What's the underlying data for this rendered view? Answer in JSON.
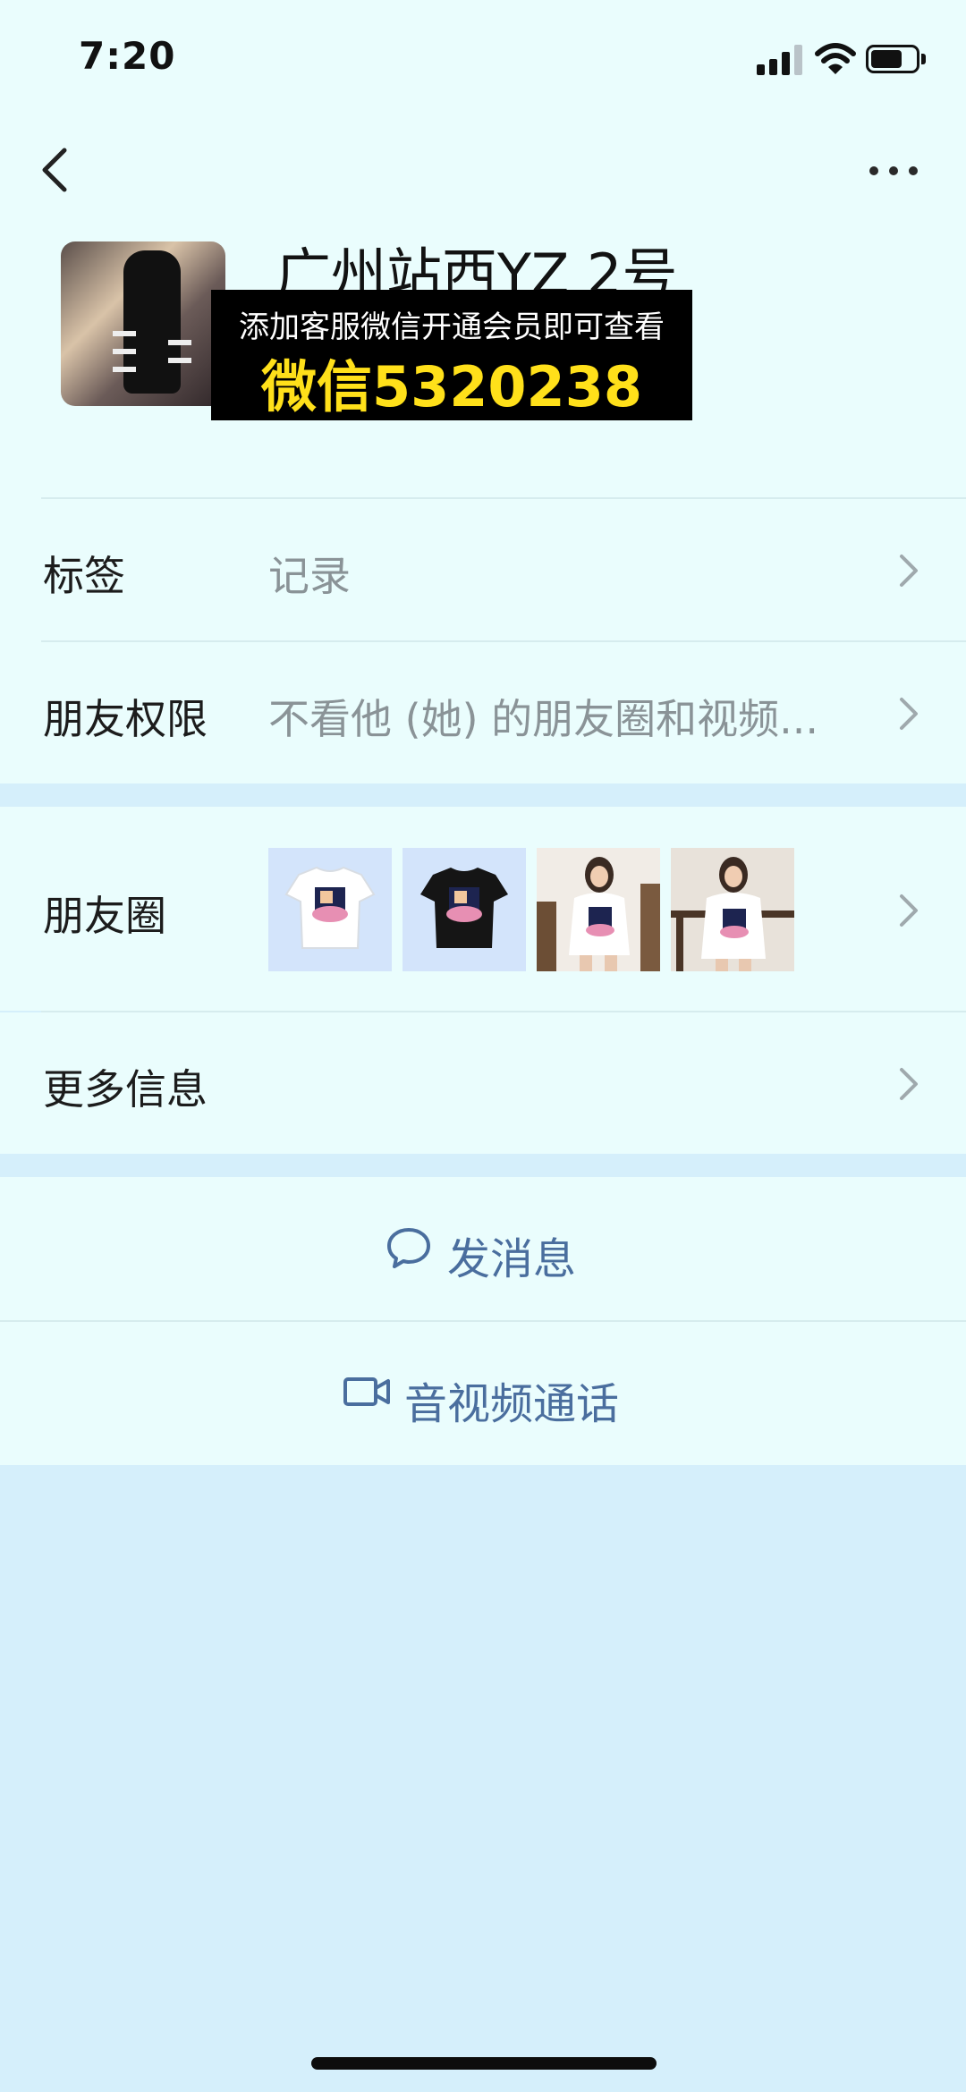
{
  "status_bar": {
    "time": "7:20"
  },
  "profile": {
    "name": "广州站西YZ 2号",
    "banner_line1": "添加客服微信开通会员即可查看",
    "banner_line2": "微信5320238"
  },
  "rows": {
    "tags": {
      "label": "标签",
      "value": "记录"
    },
    "permissions": {
      "label": "朋友权限",
      "value": "不看他 (她) 的朋友圈和视频..."
    },
    "moments": {
      "label": "朋友圈"
    },
    "more_info": {
      "label": "更多信息"
    }
  },
  "actions": {
    "message": "发消息",
    "video_call": "音视频通话"
  },
  "colors": {
    "page_bg": "#eafdfd",
    "section_bg": "#d5effb",
    "action_text": "#4a6e9e",
    "banner_text_yellow": "#ffe01a"
  },
  "icons": {
    "back": "chevron-left-icon",
    "more": "more-dots-icon",
    "row_arrow": "chevron-right-icon",
    "message": "chat-bubble-icon",
    "video": "video-camera-icon"
  }
}
